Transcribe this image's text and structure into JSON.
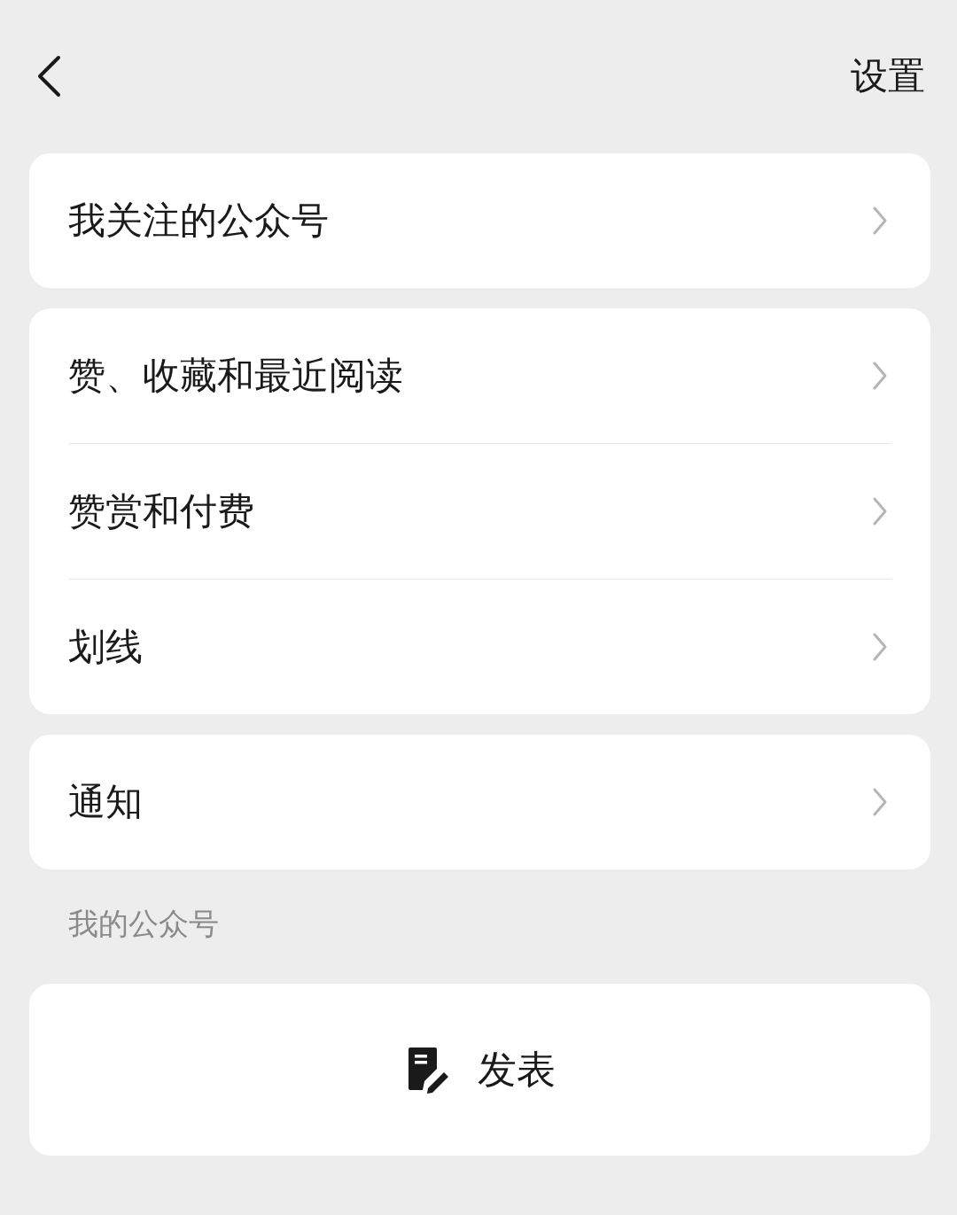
{
  "header": {
    "title": "设置"
  },
  "groups": [
    {
      "items": [
        {
          "label": "我关注的公众号"
        }
      ]
    },
    {
      "items": [
        {
          "label": "赞、收藏和最近阅读"
        },
        {
          "label": "赞赏和付费"
        },
        {
          "label": "划线"
        }
      ]
    },
    {
      "items": [
        {
          "label": "通知"
        }
      ]
    }
  ],
  "section_label": "我的公众号",
  "publish_button": {
    "label": "发表"
  }
}
